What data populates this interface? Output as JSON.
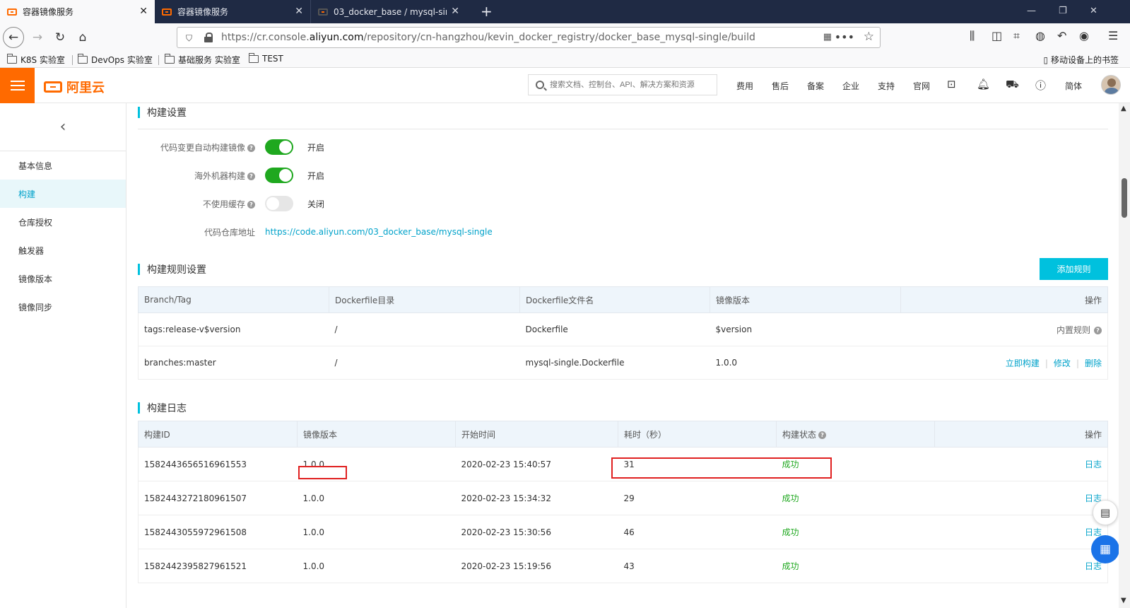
{
  "browser": {
    "tabs": [
      {
        "title": "容器镜像服务",
        "active": true
      },
      {
        "title": "容器镜像服务",
        "active": false
      },
      {
        "title": "03_docker_base / mysql-sin",
        "active": false
      }
    ],
    "url_prefix": "https://cr.console.",
    "url_domain": "aliyun.com",
    "url_path": "/repository/cn-hangzhou/kevin_docker_registry/docker_base_mysql-single/build",
    "bookmarks": [
      "K8S 实验室",
      "DevOps 实验室",
      "基础服务 实验室",
      "TEST"
    ],
    "mobile_bookmarks": "移动设备上的书签"
  },
  "header": {
    "logo_text": "阿里云",
    "search_placeholder": "搜索文档、控制台、API、解决方案和资源",
    "nav": [
      "费用",
      "售后",
      "备案",
      "企业",
      "支持",
      "官网"
    ],
    "lang": "简体"
  },
  "sidebar": {
    "items": [
      {
        "label": "基本信息",
        "active": false
      },
      {
        "label": "构建",
        "active": true
      },
      {
        "label": "仓库授权",
        "active": false
      },
      {
        "label": "触发器",
        "active": false
      },
      {
        "label": "镜像版本",
        "active": false
      },
      {
        "label": "镜像同步",
        "active": false
      }
    ]
  },
  "build_settings": {
    "title": "构建设置",
    "auto_build": {
      "label": "代码变更自动构建镜像",
      "state": "开启",
      "on": true
    },
    "overseas": {
      "label": "海外机器构建",
      "state": "开启",
      "on": true
    },
    "no_cache": {
      "label": "不使用缓存",
      "state": "关闭",
      "on": false
    },
    "repo_label": "代码仓库地址",
    "repo_url": "https://code.aliyun.com/03_docker_base/mysql-single"
  },
  "build_rules": {
    "title": "构建规则设置",
    "add_button": "添加规则",
    "columns": [
      "Branch/Tag",
      "Dockerfile目录",
      "Dockerfile文件名",
      "镜像版本",
      "操作"
    ],
    "rows": [
      {
        "branch": "tags:release-v$version",
        "dir": "/",
        "file": "Dockerfile",
        "version": "$version",
        "builtin": "内置规则"
      },
      {
        "branch": "branches:master",
        "dir": "/",
        "file": "mysql-single.Dockerfile",
        "version": "1.0.0",
        "act_build": "立即构建",
        "act_edit": "修改",
        "act_delete": "删除"
      }
    ]
  },
  "build_log": {
    "title": "构建日志",
    "columns": [
      "构建ID",
      "镜像版本",
      "开始时间",
      "耗时（秒）",
      "构建状态",
      "操作"
    ],
    "rows": [
      {
        "id": "1582443656516961553",
        "version": "1.0.0",
        "start": "2020-02-23 15:40:57",
        "duration": "31",
        "status": "成功",
        "action": "日志"
      },
      {
        "id": "1582443272180961507",
        "version": "1.0.0",
        "start": "2020-02-23 15:34:32",
        "duration": "29",
        "status": "成功",
        "action": "日志"
      },
      {
        "id": "1582443055972961508",
        "version": "1.0.0",
        "start": "2020-02-23 15:30:56",
        "duration": "46",
        "status": "成功",
        "action": "日志"
      },
      {
        "id": "1582442395827961521",
        "version": "1.0.0",
        "start": "2020-02-23 15:19:56",
        "duration": "43",
        "status": "成功",
        "action": "日志"
      }
    ]
  },
  "colors": {
    "accent": "#00c1de",
    "brand": "#ff6a00",
    "success": "#1fa81f",
    "highlight": "#e02020"
  }
}
